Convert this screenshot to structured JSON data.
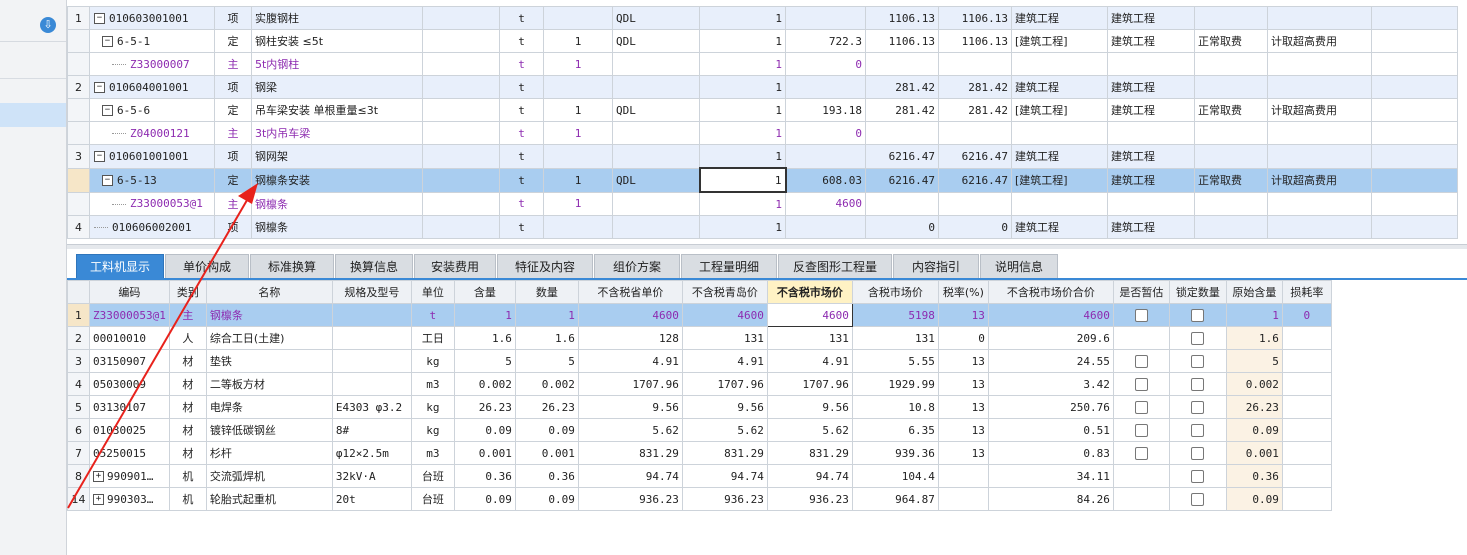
{
  "sidebar": {
    "download_icon": "download-circle-icon"
  },
  "top_rows": [
    {
      "n": "1",
      "toggle": "−",
      "code": "010603001001",
      "type": "项",
      "name": "实腹钢柱",
      "unit": "t",
      "qty": "",
      "base": "QDL",
      "flag": "1",
      "v1": "1",
      "price": "",
      "sum1": "1106.13",
      "sum2": "1106.13",
      "cat1": "建筑工程",
      "cat2": "建筑工程",
      "fee": "",
      "extra": "",
      "cls": "lvl1"
    },
    {
      "n": "",
      "toggle": "−",
      "code": "6-5-1",
      "type": "定",
      "name": "钢柱安装 ≤5t",
      "unit": "t",
      "qty": "1",
      "base": "QDL",
      "flag": "",
      "v1": "1",
      "price": "722.3",
      "sum1": "1106.13",
      "sum2": "1106.13",
      "cat1": "[建筑工程]",
      "cat2": "建筑工程",
      "fee": "正常取费",
      "extra": "计取超高费用",
      "cls": "lvl2"
    },
    {
      "n": "",
      "toggle": "",
      "code": "Z33000007",
      "type": "主",
      "name": "5t内钢柱",
      "unit": "t",
      "qty": "1",
      "base": "",
      "flag": "",
      "v1": "1",
      "price": "0",
      "sum1": "",
      "sum2": "",
      "cat1": "",
      "cat2": "",
      "fee": "",
      "extra": "",
      "cls": "lvl3"
    },
    {
      "n": "2",
      "toggle": "−",
      "code": "010604001001",
      "type": "项",
      "name": "钢梁",
      "unit": "t",
      "qty": "",
      "base": "",
      "flag": "1",
      "v1": "1",
      "price": "",
      "sum1": "281.42",
      "sum2": "281.42",
      "cat1": "建筑工程",
      "cat2": "建筑工程",
      "fee": "",
      "extra": "",
      "cls": "lvl1"
    },
    {
      "n": "",
      "toggle": "−",
      "code": "6-5-6",
      "type": "定",
      "name": "吊车梁安装 单根重量≤3t",
      "unit": "t",
      "qty": "1",
      "base": "QDL",
      "flag": "",
      "v1": "1",
      "price": "193.18",
      "sum1": "281.42",
      "sum2": "281.42",
      "cat1": "[建筑工程]",
      "cat2": "建筑工程",
      "fee": "正常取费",
      "extra": "计取超高费用",
      "cls": "lvl2"
    },
    {
      "n": "",
      "toggle": "",
      "code": "Z04000121",
      "type": "主",
      "name": "3t内吊车梁",
      "unit": "t",
      "qty": "1",
      "base": "",
      "flag": "",
      "v1": "1",
      "price": "0",
      "sum1": "",
      "sum2": "",
      "cat1": "",
      "cat2": "",
      "fee": "",
      "extra": "",
      "cls": "lvl3"
    },
    {
      "n": "3",
      "toggle": "−",
      "code": "010601001001",
      "type": "项",
      "name": "钢网架",
      "unit": "t",
      "qty": "",
      "base": "",
      "flag": "1",
      "v1": "1",
      "price": "",
      "sum1": "6216.47",
      "sum2": "6216.47",
      "cat1": "建筑工程",
      "cat2": "建筑工程",
      "fee": "",
      "extra": "",
      "cls": "lvl1"
    },
    {
      "n": "",
      "toggle": "−",
      "code": "6-5-13",
      "type": "定",
      "name": "钢檩条安装",
      "unit": "t",
      "qty": "1",
      "base": "QDL",
      "flag": "",
      "v1": "1",
      "price": "608.03",
      "sum1": "6216.47",
      "sum2": "6216.47",
      "cat1": "[建筑工程]",
      "cat2": "建筑工程",
      "fee": "正常取费",
      "extra": "计取超高费用",
      "cls": "lvl2 sel"
    },
    {
      "n": "",
      "toggle": "",
      "code": "Z33000053@1",
      "type": "主",
      "name": "钢檩条",
      "unit": "t",
      "qty": "1",
      "base": "",
      "flag": "",
      "v1": "1",
      "price": "4600",
      "sum1": "",
      "sum2": "",
      "cat1": "",
      "cat2": "",
      "fee": "",
      "extra": "",
      "cls": "lvl3"
    },
    {
      "n": "4",
      "toggle": "",
      "code": "010606002001",
      "type": "项",
      "name": "钢檩条",
      "unit": "t",
      "qty": "",
      "base": "",
      "flag": "1",
      "v1": "1",
      "price": "",
      "sum1": "0",
      "sum2": "0",
      "cat1": "建筑工程",
      "cat2": "建筑工程",
      "fee": "",
      "extra": "",
      "cls": "lvl1"
    }
  ],
  "tabs": [
    "工料机显示",
    "单价构成",
    "标准换算",
    "换算信息",
    "安装费用",
    "特征及内容",
    "组价方案",
    "工程量明细",
    "反查图形工程量",
    "内容指引",
    "说明信息"
  ],
  "bottom_headers": [
    "",
    "编码",
    "类别",
    "名称",
    "规格及型号",
    "单位",
    "含量",
    "数量",
    "不含税省单价",
    "不含税青岛价",
    "不含税市场价",
    "含税市场价",
    "税率(%)",
    "不含税市场价合价",
    "是否暂估",
    "锁定数量",
    "原始含量",
    "损耗率"
  ],
  "bottom_rows": [
    {
      "n": "1",
      "code": "Z33000053@1",
      "cat": "主",
      "name": "钢檩条",
      "spec": "",
      "unit": "t",
      "content": "1",
      "qty": "1",
      "p1": "4600",
      "p2": "4600",
      "p3": "4600",
      "p4": "5198",
      "tax": "13",
      "total": "4600",
      "est": true,
      "lock": true,
      "orig": "1",
      "loss": "0",
      "plus": false,
      "purple": true,
      "sel": true
    },
    {
      "n": "2",
      "code": "00010010",
      "cat": "人",
      "name": "综合工日(土建)",
      "spec": "",
      "unit": "工日",
      "content": "1.6",
      "qty": "1.6",
      "p1": "128",
      "p2": "131",
      "p3": "131",
      "p4": "131",
      "tax": "0",
      "total": "209.6",
      "est": false,
      "lock": true,
      "orig": "1.6",
      "loss": "",
      "plus": false,
      "purple": false,
      "sel": false
    },
    {
      "n": "3",
      "code": "03150907",
      "cat": "材",
      "name": "垫铁",
      "spec": "",
      "unit": "kg",
      "content": "5",
      "qty": "5",
      "p1": "4.91",
      "p2": "4.91",
      "p3": "4.91",
      "p4": "5.55",
      "tax": "13",
      "total": "24.55",
      "est": true,
      "lock": true,
      "orig": "5",
      "loss": "",
      "plus": false,
      "purple": false,
      "sel": false
    },
    {
      "n": "4",
      "code": "05030009",
      "cat": "材",
      "name": "二等板方材",
      "spec": "",
      "unit": "m3",
      "content": "0.002",
      "qty": "0.002",
      "p1": "1707.96",
      "p2": "1707.96",
      "p3": "1707.96",
      "p4": "1929.99",
      "tax": "13",
      "total": "3.42",
      "est": true,
      "lock": true,
      "orig": "0.002",
      "loss": "",
      "plus": false,
      "purple": false,
      "sel": false
    },
    {
      "n": "5",
      "code": "03130107",
      "cat": "材",
      "name": "电焊条",
      "spec": "E4303 φ3.2",
      "unit": "kg",
      "content": "26.23",
      "qty": "26.23",
      "p1": "9.56",
      "p2": "9.56",
      "p3": "9.56",
      "p4": "10.8",
      "tax": "13",
      "total": "250.76",
      "est": true,
      "lock": true,
      "orig": "26.23",
      "loss": "",
      "plus": false,
      "purple": false,
      "sel": false
    },
    {
      "n": "6",
      "code": "01030025",
      "cat": "材",
      "name": "镀锌低碳钢丝",
      "spec": "8#",
      "unit": "kg",
      "content": "0.09",
      "qty": "0.09",
      "p1": "5.62",
      "p2": "5.62",
      "p3": "5.62",
      "p4": "6.35",
      "tax": "13",
      "total": "0.51",
      "est": true,
      "lock": true,
      "orig": "0.09",
      "loss": "",
      "plus": false,
      "purple": false,
      "sel": false
    },
    {
      "n": "7",
      "code": "05250015",
      "cat": "材",
      "name": "杉杆",
      "spec": "φ12×2.5m",
      "unit": "m3",
      "content": "0.001",
      "qty": "0.001",
      "p1": "831.29",
      "p2": "831.29",
      "p3": "831.29",
      "p4": "939.36",
      "tax": "13",
      "total": "0.83",
      "est": true,
      "lock": true,
      "orig": "0.001",
      "loss": "",
      "plus": false,
      "purple": false,
      "sel": false
    },
    {
      "n": "8",
      "code": "990901…",
      "cat": "机",
      "name": "交流弧焊机",
      "spec": "32kV·A",
      "unit": "台班",
      "content": "0.36",
      "qty": "0.36",
      "p1": "94.74",
      "p2": "94.74",
      "p3": "94.74",
      "p4": "104.4",
      "tax": "",
      "total": "34.11",
      "est": false,
      "lock": true,
      "orig": "0.36",
      "loss": "",
      "plus": true,
      "purple": false,
      "sel": false
    },
    {
      "n": "14",
      "code": "990303…",
      "cat": "机",
      "name": "轮胎式起重机",
      "spec": "20t",
      "unit": "台班",
      "content": "0.09",
      "qty": "0.09",
      "p1": "936.23",
      "p2": "936.23",
      "p3": "936.23",
      "p4": "964.87",
      "tax": "",
      "total": "84.26",
      "est": false,
      "lock": true,
      "orig": "0.09",
      "loss": "",
      "plus": true,
      "purple": false,
      "sel": false
    }
  ],
  "colors": {
    "accent": "#3a89d6",
    "selection": "#a9cdf0",
    "purple": "#8d2bb0",
    "arrow": "#e8221c"
  }
}
